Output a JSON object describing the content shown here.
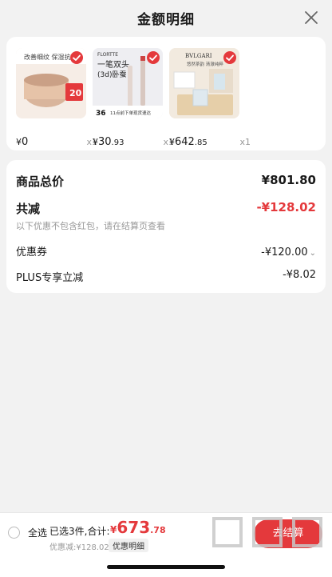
{
  "header": {
    "title": "金额明细"
  },
  "products": [
    {
      "price_symbol": "¥",
      "price_int": "0",
      "price_dec": "",
      "qty": "x1",
      "badge_text": "改善细纹 保湿抗",
      "promo_text": "20",
      "icon": "cream-jar-thumbnail"
    },
    {
      "price_symbol": "¥",
      "price_int": "30",
      "price_dec": ".93",
      "qty": "x1",
      "brand": "FLORTTE",
      "line1": "一笔双头",
      "line2": "(3d)卧蚕",
      "promo_price": "36",
      "promo_text": "11点前下单现货速达",
      "icon": "eyeliner-pen-thumbnail"
    },
    {
      "price_symbol": "¥",
      "price_int": "642",
      "price_dec": ".85",
      "qty": "x1",
      "brand": "BVLGARI",
      "line1": "悠然茶韵 清澈纯粹",
      "icon": "perfume-set-thumbnail"
    }
  ],
  "summary": {
    "total_label": "商品总价",
    "total_value": "¥801.80",
    "reduce_label": "共减",
    "reduce_value": "-¥128.02",
    "note": "以下优惠不包含红包，请在结算页查看",
    "coupon_label": "优惠券",
    "coupon_value": "-¥120.00",
    "plus_label": "PLUS专享立减",
    "plus_value": "-¥8.02"
  },
  "bottom": {
    "select_all": "全选",
    "selected_count": "已选3件,合计:",
    "total_symbol": "¥",
    "total_int": "673",
    "total_dec": ".78",
    "discount_text": "优惠减:¥128.02",
    "detail_button": "优惠明细",
    "checkout_button": "去结算"
  },
  "colors": {
    "accent": "#e4393c"
  }
}
